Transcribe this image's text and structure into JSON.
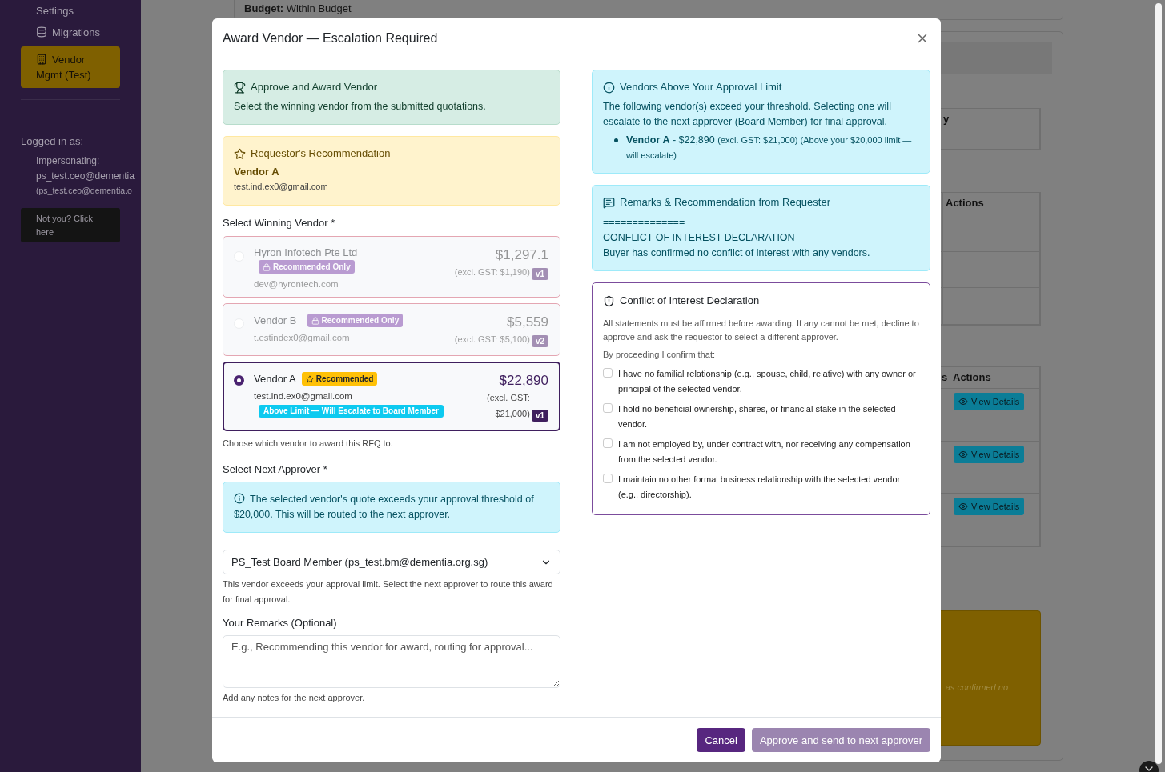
{
  "sidebar": {
    "items": [
      {
        "label": "Settings",
        "kind": "plain",
        "selected": false
      },
      {
        "label": "Migrations",
        "kind": "database",
        "selected": false
      },
      {
        "label": "Vendor Mgmt (Test)",
        "kind": "building",
        "selected": true
      }
    ]
  },
  "session": {
    "heading": "Logged in as:",
    "impersonating_label": "Impersonating:",
    "email": "ps_test.ceo@dementia",
    "email_secondary": "(ps_test.ceo@dementia.o",
    "switch_button": "Not you? Click here"
  },
  "page": {
    "budget": "**Budget:** Within Budget",
    "tables": [
      {
        "headers": [
          "y"
        ],
        "rows": [
          [
            ""
          ]
        ]
      },
      {
        "headers": [
          "Actions"
        ],
        "rows": [
          [
            ""
          ],
          [
            ""
          ],
          [
            ""
          ]
        ]
      },
      {
        "headers": [
          "s",
          "Actions"
        ],
        "rows": [
          [
            "",
            "View Details"
          ],
          [
            "",
            "View Details"
          ],
          [
            "",
            "View Details"
          ]
        ]
      }
    ],
    "note": "as confirmed no"
  },
  "modal": {
    "title": "Award Vendor — Escalation Required",
    "award_alert": {
      "title": "Approve and Award Vendor",
      "text": "Select the winning vendor from the submitted quotations."
    },
    "recommendation": {
      "title": "Requestor's Recommendation",
      "vendor": "Vendor A",
      "email": "test.ind.ex0@gmail.com"
    },
    "vendor_label": "Select Winning Vendor *",
    "vendors": [
      {
        "name": "Hyron Infotech Pte Ltd",
        "badge": {
          "kind": "restricted",
          "label": "Recommended Only"
        },
        "email": "dev@hyrontech.com",
        "price": "$1,297.1",
        "excl_gst": "(excl. GST: $1,190)",
        "version": "v1",
        "disabled": true,
        "selected": false
      },
      {
        "name": "Vendor B",
        "badge": {
          "kind": "restricted",
          "label": "Recommended Only"
        },
        "email": "t.estindex0@gmail.com",
        "price": "$5,559",
        "excl_gst": "(excl. GST: $5,100)",
        "version": "v2",
        "disabled": true,
        "selected": false
      },
      {
        "name": "Vendor A",
        "badge": {
          "kind": "recommended",
          "label": "Recommended"
        },
        "email": "test.ind.ex0@gmail.com",
        "escalation": "Above Limit — Will Escalate to Board Member",
        "price": "$22,890",
        "excl_gst": "(excl. GST: $21,000)",
        "version": "v1",
        "disabled": false,
        "selected": true
      }
    ],
    "vendor_help": "Choose which vendor to award this RFQ to.",
    "approver_label": "Select Next Approver *",
    "threshold_alert": "The selected vendor's quote exceeds your approval threshold of $20,000. This will be routed to the next approver.",
    "approver_value": "PS_Test Board Member (ps_test.bm@dementia.org.sg)",
    "approver_help": "This vendor exceeds your approval limit. Select the next approver to route this award for final approval.",
    "remarks_label": "Your Remarks (Optional)",
    "remarks_placeholder": "E.g., Recommending this vendor for award, routing for approval...",
    "remarks_help": "Add any notes for the next approver.",
    "limit_alert": {
      "title": "Vendors Above Your Approval Limit",
      "text": "The following vendor(s) exceed your threshold. Selecting one will escalate to the next approver (Board Member) for final approval.",
      "items": [
        {
          "vendor": "Vendor A",
          "amount": "- $22,890",
          "note": "(excl. GST: $21,000) (Above your $20,000 limit — will escalate)"
        }
      ]
    },
    "requester_remarks": {
      "title": "Remarks & Recommendation from Requester",
      "lines": [
        "==============",
        "CONFLICT OF INTEREST DECLARATION",
        "Buyer has confirmed no conflict of interest with any vendors."
      ]
    },
    "coi": {
      "title": "Conflict of Interest Declaration",
      "intro": "All statements must be affirmed before awarding. If any cannot be met, decline to approve and ask the requestor to select a different approver.",
      "lead": "By proceeding I confirm that:",
      "statements": [
        {
          "text": "I have no familial relationship (e.g., spouse, child, relative) with any owner or principal of the selected vendor.",
          "checked": false
        },
        {
          "text": "I hold no beneficial ownership, shares, or financial stake in the selected vendor.",
          "checked": false
        },
        {
          "text": "I am not employed by, under contract with, nor receiving any compensation from the selected vendor.",
          "checked": false
        },
        {
          "text": "I maintain no other formal business relationship with the selected vendor (e.g., directorship).",
          "checked": false
        }
      ]
    },
    "buttons": [
      {
        "label": "Cancel",
        "kind": "secondary",
        "disabled": false
      },
      {
        "label": "Approve and send to next approver",
        "kind": "primary",
        "disabled": true
      }
    ]
  }
}
